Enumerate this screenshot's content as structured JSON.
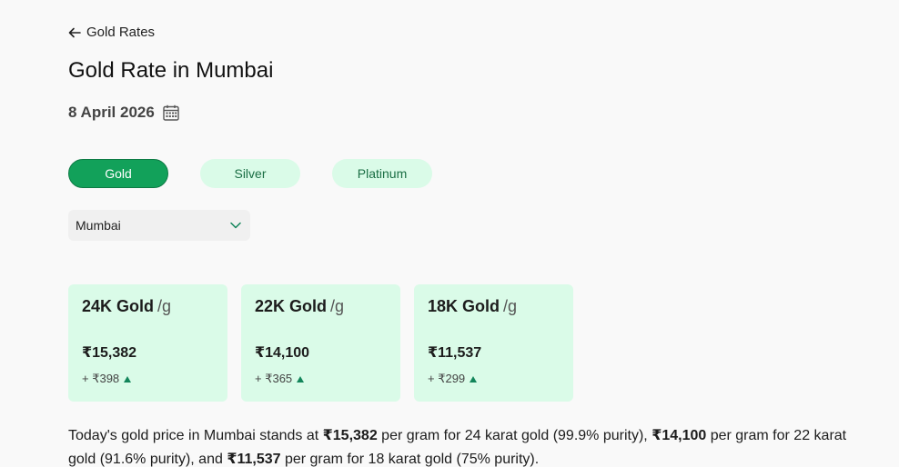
{
  "breadcrumb": {
    "back_label": "Gold Rates"
  },
  "header": {
    "title": "Gold Rate in Mumbai",
    "date": "8 April 2026"
  },
  "metal_tabs": [
    {
      "label": "Gold",
      "active": true
    },
    {
      "label": "Silver",
      "active": false
    },
    {
      "label": "Platinum",
      "active": false
    }
  ],
  "city_select": {
    "value": "Mumbai"
  },
  "cards": [
    {
      "title": "24K Gold",
      "unit": "/g",
      "price": "₹15,382",
      "change": "+ ₹398"
    },
    {
      "title": "22K Gold",
      "unit": "/g",
      "price": "₹14,100",
      "change": "+ ₹365"
    },
    {
      "title": "18K Gold",
      "unit": "/g",
      "price": "₹11,537",
      "change": "+ ₹299"
    }
  ],
  "description": {
    "part1": "Today's gold price in Mumbai stands at ",
    "price24": "₹15,382",
    "part2": " per gram for 24 karat gold (99.9% purity), ",
    "price22": "₹14,100",
    "part3": " per gram for 22 karat gold (91.6% purity), and ",
    "price18": "₹11,537",
    "part4": " per gram for 18 karat gold (75% purity)."
  },
  "colors": {
    "accent": "#12a15a",
    "card_bg": "#dafbe8",
    "up_arrow": "#12855a"
  }
}
